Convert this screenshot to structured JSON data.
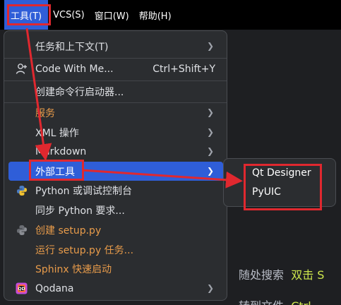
{
  "menubar": {
    "items": [
      {
        "label": "工具(T)"
      },
      {
        "label": "VCS(S)"
      },
      {
        "label": "窗口(W)"
      },
      {
        "label": "帮助(H)"
      }
    ]
  },
  "tools_menu": {
    "items": [
      {
        "label": "任务和上下文(T)",
        "submenu": true
      },
      {
        "label": "Code With Me...",
        "shortcut": "Ctrl+Shift+Y"
      },
      {
        "label": "创建命令行启动器..."
      },
      {
        "label": "服务",
        "submenu": true
      },
      {
        "label": "XML 操作",
        "submenu": true
      },
      {
        "label": "Markdown",
        "submenu": true
      },
      {
        "label": "外部工具",
        "submenu": true,
        "selected": true
      },
      {
        "label": "Python 或调试控制台"
      },
      {
        "label": "同步 Python 要求..."
      },
      {
        "label": "创建 setup.py"
      },
      {
        "label": "运行 setup.py 任务..."
      },
      {
        "label": "Sphinx 快速启动"
      },
      {
        "label": "Qodana",
        "submenu": true
      }
    ]
  },
  "external_tools_submenu": {
    "items": [
      {
        "label": "Qt Designer"
      },
      {
        "label": "PyUIC"
      }
    ]
  },
  "background": {
    "line1_prefix": "随处搜索",
    "line1_highlight": "双击 S",
    "line2_prefix": "转到文件",
    "line2_highlight": "Ctrl"
  },
  "colors": {
    "accent": "#2f5ed8",
    "annotation_red": "#e0282f",
    "disabled_orange": "#e89b4a"
  }
}
